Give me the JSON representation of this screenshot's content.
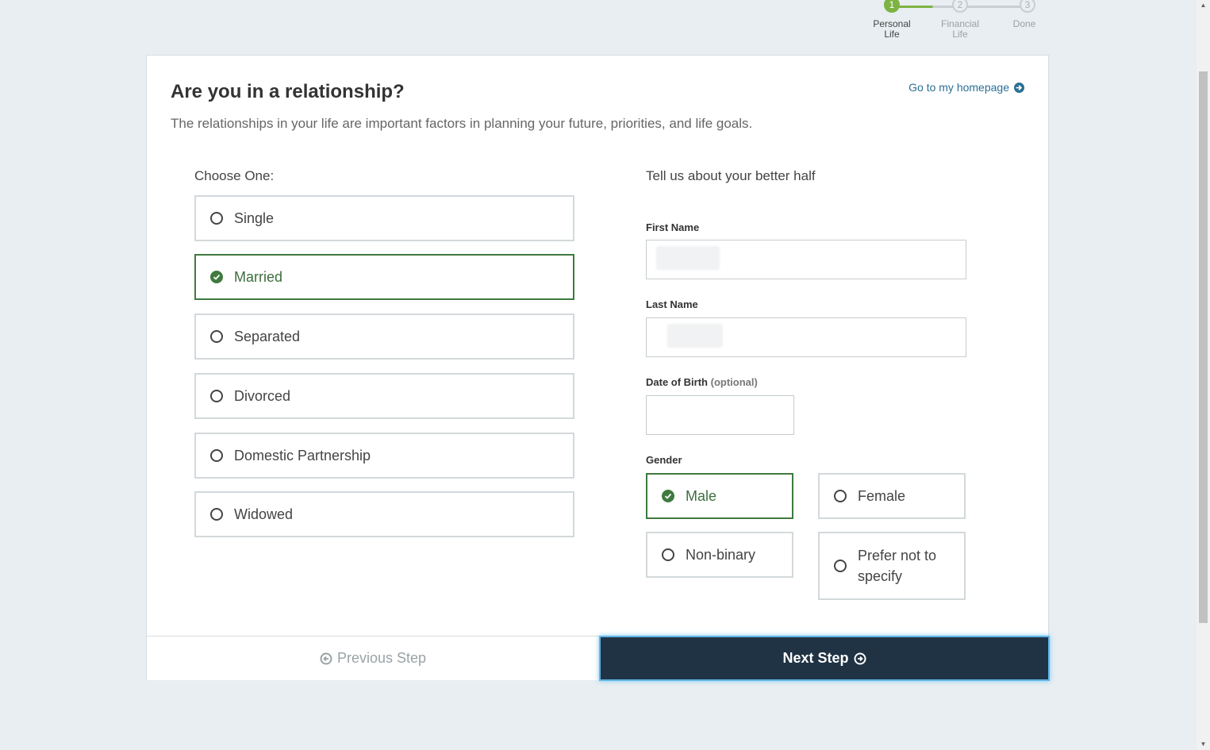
{
  "stepper": {
    "steps": [
      {
        "number": "1",
        "label": "Personal\nLife",
        "state": "active"
      },
      {
        "number": "2",
        "label": "Financial\nLife",
        "state": "inactive"
      },
      {
        "number": "3",
        "label": "Done",
        "state": "inactive"
      }
    ]
  },
  "card": {
    "title": "Are you in a relationship?",
    "subtitle": "The relationships in your life are important factors in planning your future, priorities, and life goals.",
    "home_link": "Go to my homepage",
    "choose_label": "Choose One:",
    "relationship_options": [
      {
        "label": "Single",
        "selected": false
      },
      {
        "label": "Married",
        "selected": true
      },
      {
        "label": "Separated",
        "selected": false
      },
      {
        "label": "Divorced",
        "selected": false
      },
      {
        "label": "Domestic Partnership",
        "selected": false
      },
      {
        "label": "Widowed",
        "selected": false
      }
    ],
    "partner": {
      "heading": "Tell us about your better half",
      "first_name_label": "First Name",
      "first_name_value": "",
      "last_name_label": "Last Name",
      "last_name_value": "",
      "dob_label": "Date of Birth",
      "dob_optional": "(optional)",
      "dob_value": "",
      "gender_label": "Gender",
      "gender_options": [
        {
          "label": "Male",
          "selected": true
        },
        {
          "label": "Female",
          "selected": false
        },
        {
          "label": "Non-binary",
          "selected": false
        },
        {
          "label": "Prefer not to specify",
          "selected": false
        }
      ]
    },
    "prev_button": "Previous Step",
    "next_button": "Next Step"
  },
  "colors": {
    "accent_green": "#3f7a3f",
    "step_green": "#7cb342",
    "next_button_bg": "#1f3344",
    "link_blue": "#2b6f94"
  }
}
